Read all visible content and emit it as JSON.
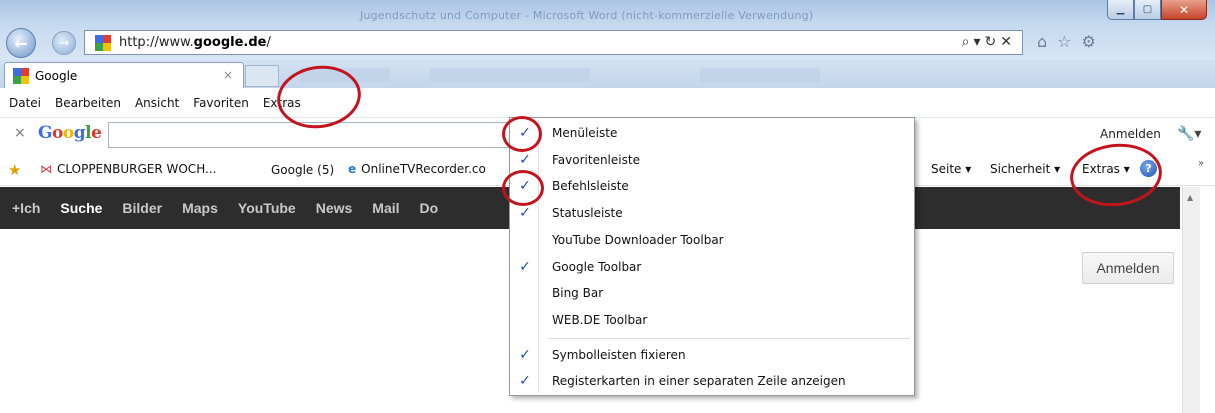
{
  "window": {
    "title": "Jugendschutz und Computer - Microsoft Word (nicht-kommerzielle Verwendung)"
  },
  "address": {
    "url_prefix": "http://www.",
    "url_domain": "google.de",
    "url_suffix": "/"
  },
  "tab": {
    "title": "Google",
    "close": "×"
  },
  "menubar": [
    "Datei",
    "Bearbeiten",
    "Ansicht",
    "Favoriten",
    "Extras"
  ],
  "google_toolbar": {
    "close": "×",
    "logo": [
      "G",
      "o",
      "o",
      "g",
      "l",
      "e"
    ],
    "signin": "Anmelden"
  },
  "favorites": [
    {
      "label": "CLOPPENBURGER WOCH...",
      "icon": "bow-icon"
    },
    {
      "label": "Google (5)",
      "icon": "google-icon"
    },
    {
      "label": "OnlineTVRecorder.co",
      "icon": "ie-icon"
    }
  ],
  "command_bar": [
    "Seite ▾",
    "Sicherheit ▾",
    "Extras ▾"
  ],
  "gbar": [
    "+Ich",
    "Suche",
    "Bilder",
    "Maps",
    "YouTube",
    "News",
    "Mail",
    "Do"
  ],
  "page": {
    "signin_button": "Anmelden"
  },
  "context_menu": [
    {
      "label": "Menüleiste",
      "checked": true
    },
    {
      "label": "Favoritenleiste",
      "checked": true
    },
    {
      "label": "Befehlsleiste",
      "checked": true
    },
    {
      "label": "Statusleiste",
      "checked": true
    },
    {
      "label": "YouTube Downloader Toolbar",
      "checked": false
    },
    {
      "label": "Google Toolbar",
      "checked": true
    },
    {
      "label": "Bing Bar",
      "checked": false
    },
    {
      "label": "WEB.DE Toolbar",
      "checked": false
    },
    {
      "label": "Symbolleisten fixieren",
      "checked": true
    },
    {
      "label": "Registerkarten in einer separaten Zeile anzeigen",
      "checked": true
    }
  ],
  "check_glyph": "✓",
  "colors": {
    "annotation": "#c3141e",
    "check": "#1f4fb4",
    "gbar": "#2d2d2d"
  }
}
